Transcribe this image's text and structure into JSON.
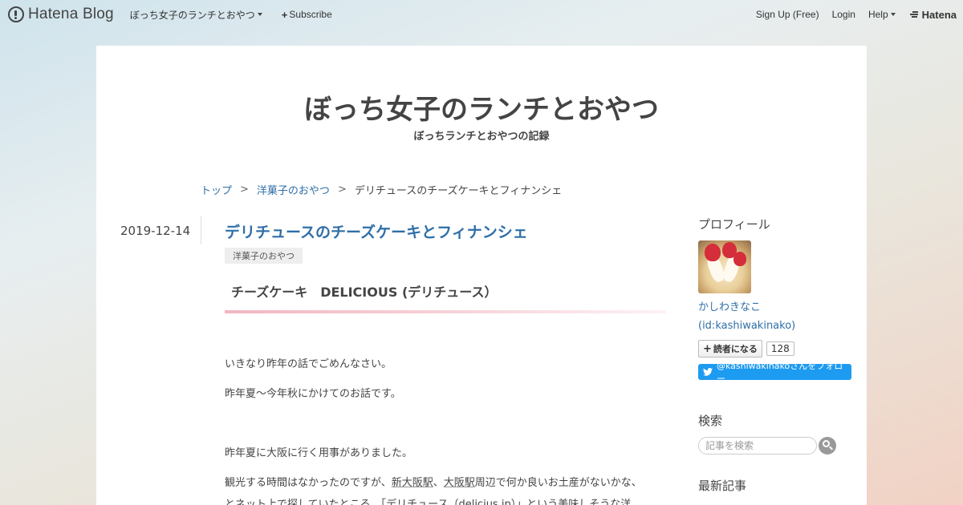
{
  "topbar": {
    "brand": "Hatena Blog",
    "blog_menu": "ぼっち女子のランチとおやつ",
    "subscribe": "Subscribe",
    "signup": "Sign Up (Free)",
    "login": "Login",
    "help": "Help",
    "hatena": "Hatena"
  },
  "blog": {
    "title": "ぼっち女子のランチとおやつ",
    "description": "ぼっちランチとおやつの記録"
  },
  "breadcrumb": {
    "top": "トップ",
    "separator": ">",
    "category": "洋菓子のおやつ",
    "current": "デリチュースのチーズケーキとフィナンシェ"
  },
  "entry": {
    "date": "2019-12-14",
    "title": "デリチュースのチーズケーキとフィナンシェ",
    "category": "洋菓子のおやつ",
    "heading": "チーズケーキ　DELICIOUS (デリチュース）",
    "p1": "いきなり昨年の話でごめんなさい。",
    "p2": "昨年夏～今年秋にかけてのお話です。",
    "p3": "昨年夏に大阪に行く用事がありました。",
    "p4_a": "観光する時間はなかったのですが、",
    "p4_link1": "新大阪駅",
    "p4_b": "、",
    "p4_link2": "大阪駅",
    "p4_c": "周辺で何か良いお土産がないかな、",
    "p5": "とネット上で探していたところ、「デリチュース（delicius.jp）」という美味しそうな洋"
  },
  "sidebar": {
    "profile_heading": "プロフィール",
    "profile_name": "かしわきなこ",
    "profile_id": "(id:kashiwakinako)",
    "reader_button": "読者になる",
    "reader_count": "128",
    "twitter_follow": "@kashiwakinakoさんをフォロー",
    "search_heading": "検索",
    "search_placeholder": "記事を検索",
    "latest_heading": "最新記事"
  },
  "colors": {
    "link": "#2f6fa7",
    "twitter": "#1d9bf0",
    "heading_bar": "#f2b6c1"
  }
}
